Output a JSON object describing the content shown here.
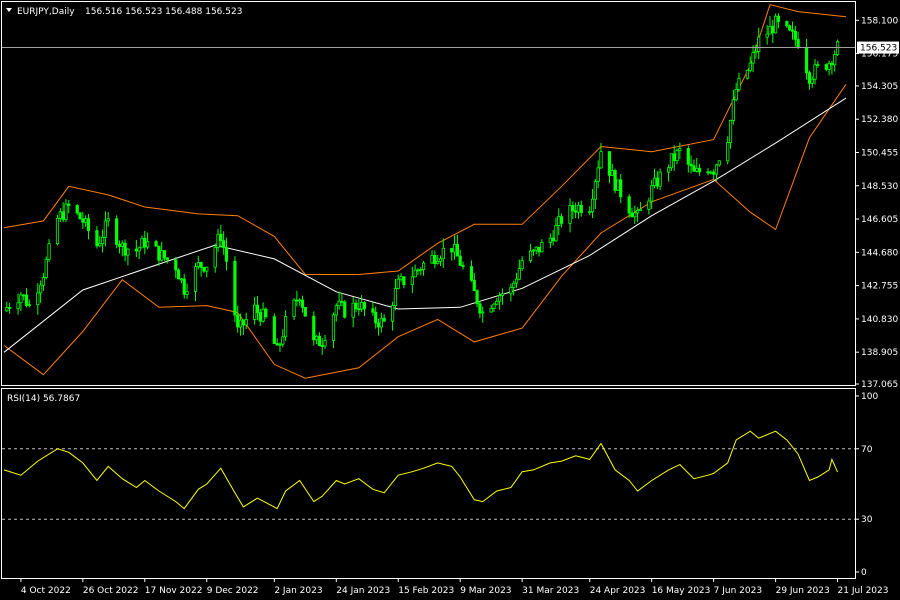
{
  "header": {
    "symbol": "EURJPY,Daily",
    "ohlc": "156.516 156.523 156.488 156.523"
  },
  "current_price_label": "156.523",
  "rsi_header": "RSI(14) 56.7867",
  "colors": {
    "background": "#000000",
    "frame": "#ffffff",
    "candle_up": "#00ff00",
    "candle_down": "#ffffff",
    "bollinger": "#ff7f00",
    "moving_average": "#ffffff",
    "rsi": "#ffff00",
    "rsi_levels": "#c0c0c0"
  },
  "chart_data": [
    {
      "type": "line",
      "name": "price",
      "x_type": "date",
      "x_range": [
        "2022-09-28",
        "2023-07-24"
      ],
      "y_range": [
        137.065,
        159.1
      ],
      "y_ticks": [
        "158.100",
        "156.175",
        "154.305",
        "152.380",
        "150.455",
        "148.530",
        "146.605",
        "144.680",
        "142.755",
        "140.830",
        "138.905",
        "137.065"
      ],
      "x_ticks": [
        {
          "date": "2022-10-04",
          "label": "4 Oct 2022"
        },
        {
          "date": "2022-10-26",
          "label": "26 Oct 2022"
        },
        {
          "date": "2022-11-17",
          "label": "17 Nov 2022"
        },
        {
          "date": "2022-12-09",
          "label": "9 Dec 2022"
        },
        {
          "date": "2023-01-02",
          "label": "2 Jan 2023"
        },
        {
          "date": "2023-01-24",
          "label": "24 Jan 2023"
        },
        {
          "date": "2023-02-15",
          "label": "15 Feb 2023"
        },
        {
          "date": "2023-03-09",
          "label": "9 Mar 2023"
        },
        {
          "date": "2023-03-31",
          "label": "31 Mar 2023"
        },
        {
          "date": "2023-04-24",
          "label": "24 Apr 2023"
        },
        {
          "date": "2023-05-16",
          "label": "16 May 2023"
        },
        {
          "date": "2023-06-07",
          "label": "7 Jun 2023"
        },
        {
          "date": "2023-06-29",
          "label": "29 Jun 2023"
        },
        {
          "date": "2023-07-21",
          "label": "21 Jul 2023"
        }
      ],
      "current_price": 156.523,
      "close": [
        {
          "date": "2022-09-29",
          "value": 141.5
        },
        {
          "date": "2022-10-04",
          "value": 142.3
        },
        {
          "date": "2022-10-07",
          "value": 141.6
        },
        {
          "date": "2022-10-12",
          "value": 143.5
        },
        {
          "date": "2022-10-17",
          "value": 146.6
        },
        {
          "date": "2022-10-21",
          "value": 147.3
        },
        {
          "date": "2022-10-26",
          "value": 146.5
        },
        {
          "date": "2022-10-31",
          "value": 145.1
        },
        {
          "date": "2022-11-04",
          "value": 146.4
        },
        {
          "date": "2022-11-09",
          "value": 145.0
        },
        {
          "date": "2022-11-14",
          "value": 144.8
        },
        {
          "date": "2022-11-17",
          "value": 145.3
        },
        {
          "date": "2022-11-22",
          "value": 144.6
        },
        {
          "date": "2022-11-28",
          "value": 143.9
        },
        {
          "date": "2022-12-01",
          "value": 142.6
        },
        {
          "date": "2022-12-06",
          "value": 143.9
        },
        {
          "date": "2022-12-09",
          "value": 144.0
        },
        {
          "date": "2022-12-14",
          "value": 145.7
        },
        {
          "date": "2022-12-16",
          "value": 144.2
        },
        {
          "date": "2022-12-20",
          "value": 140.1
        },
        {
          "date": "2022-12-26",
          "value": 141.4
        },
        {
          "date": "2022-12-30",
          "value": 140.8
        },
        {
          "date": "2023-01-03",
          "value": 138.9
        },
        {
          "date": "2023-01-06",
          "value": 140.6
        },
        {
          "date": "2023-01-11",
          "value": 142.3
        },
        {
          "date": "2023-01-16",
          "value": 139.4
        },
        {
          "date": "2023-01-19",
          "value": 139.6
        },
        {
          "date": "2023-01-24",
          "value": 141.6
        },
        {
          "date": "2023-01-27",
          "value": 141.3
        },
        {
          "date": "2023-02-01",
          "value": 141.7
        },
        {
          "date": "2023-02-06",
          "value": 140.8
        },
        {
          "date": "2023-02-10",
          "value": 140.6
        },
        {
          "date": "2023-02-15",
          "value": 142.8
        },
        {
          "date": "2023-02-20",
          "value": 143.4
        },
        {
          "date": "2023-02-24",
          "value": 144.0
        },
        {
          "date": "2023-03-01",
          "value": 144.6
        },
        {
          "date": "2023-03-06",
          "value": 145.0
        },
        {
          "date": "2023-03-09",
          "value": 144.1
        },
        {
          "date": "2023-03-14",
          "value": 142.3
        },
        {
          "date": "2023-03-17",
          "value": 141.2
        },
        {
          "date": "2023-03-22",
          "value": 142.2
        },
        {
          "date": "2023-03-27",
          "value": 142.5
        },
        {
          "date": "2023-03-31",
          "value": 144.2
        },
        {
          "date": "2023-04-04",
          "value": 144.6
        },
        {
          "date": "2023-04-10",
          "value": 145.5
        },
        {
          "date": "2023-04-14",
          "value": 146.6
        },
        {
          "date": "2023-04-19",
          "value": 147.3
        },
        {
          "date": "2023-04-24",
          "value": 147.4
        },
        {
          "date": "2023-04-28",
          "value": 150.6
        },
        {
          "date": "2023-05-03",
          "value": 148.7
        },
        {
          "date": "2023-05-08",
          "value": 147.3
        },
        {
          "date": "2023-05-11",
          "value": 146.7
        },
        {
          "date": "2023-05-16",
          "value": 148.3
        },
        {
          "date": "2023-05-22",
          "value": 149.8
        },
        {
          "date": "2023-05-26",
          "value": 150.5
        },
        {
          "date": "2023-05-31",
          "value": 149.2
        },
        {
          "date": "2023-06-05",
          "value": 149.6
        },
        {
          "date": "2023-06-07",
          "value": 149.5
        },
        {
          "date": "2023-06-12",
          "value": 151.4
        },
        {
          "date": "2023-06-15",
          "value": 154.1
        },
        {
          "date": "2023-06-20",
          "value": 155.5
        },
        {
          "date": "2023-06-23",
          "value": 156.9
        },
        {
          "date": "2023-06-29",
          "value": 157.9
        },
        {
          "date": "2023-07-03",
          "value": 157.4
        },
        {
          "date": "2023-07-07",
          "value": 156.9
        },
        {
          "date": "2023-07-11",
          "value": 154.9
        },
        {
          "date": "2023-07-14",
          "value": 155.3
        },
        {
          "date": "2023-07-18",
          "value": 155.7
        },
        {
          "date": "2023-07-21",
          "value": 156.523
        }
      ],
      "moving_average": [
        {
          "date": "2022-09-28",
          "value": 138.9
        },
        {
          "date": "2022-10-26",
          "value": 142.5
        },
        {
          "date": "2022-11-22",
          "value": 144.0
        },
        {
          "date": "2022-12-12",
          "value": 145.1
        },
        {
          "date": "2023-01-02",
          "value": 144.3
        },
        {
          "date": "2023-01-24",
          "value": 142.4
        },
        {
          "date": "2023-02-15",
          "value": 141.4
        },
        {
          "date": "2023-03-09",
          "value": 141.5
        },
        {
          "date": "2023-03-31",
          "value": 142.6
        },
        {
          "date": "2023-04-24",
          "value": 144.5
        },
        {
          "date": "2023-05-16",
          "value": 146.8
        },
        {
          "date": "2023-06-07",
          "value": 148.8
        },
        {
          "date": "2023-06-29",
          "value": 151.0
        },
        {
          "date": "2023-07-24",
          "value": 153.6
        }
      ],
      "bollinger_upper": [
        {
          "date": "2022-09-28",
          "value": 146.1
        },
        {
          "date": "2022-10-12",
          "value": 146.5
        },
        {
          "date": "2022-10-21",
          "value": 148.5
        },
        {
          "date": "2022-11-04",
          "value": 148.0
        },
        {
          "date": "2022-11-17",
          "value": 147.3
        },
        {
          "date": "2022-12-06",
          "value": 146.9
        },
        {
          "date": "2022-12-20",
          "value": 146.8
        },
        {
          "date": "2023-01-02",
          "value": 145.6
        },
        {
          "date": "2023-01-13",
          "value": 143.4
        },
        {
          "date": "2023-02-01",
          "value": 143.4
        },
        {
          "date": "2023-02-15",
          "value": 143.6
        },
        {
          "date": "2023-03-01",
          "value": 145.2
        },
        {
          "date": "2023-03-14",
          "value": 146.3
        },
        {
          "date": "2023-03-31",
          "value": 146.3
        },
        {
          "date": "2023-04-14",
          "value": 148.5
        },
        {
          "date": "2023-04-28",
          "value": 150.8
        },
        {
          "date": "2023-05-16",
          "value": 150.5
        },
        {
          "date": "2023-06-07",
          "value": 151.2
        },
        {
          "date": "2023-06-20",
          "value": 155.5
        },
        {
          "date": "2023-06-27",
          "value": 159.0
        },
        {
          "date": "2023-07-07",
          "value": 158.6
        },
        {
          "date": "2023-07-24",
          "value": 158.3
        }
      ],
      "bollinger_lower": [
        {
          "date": "2022-09-28",
          "value": 139.3
        },
        {
          "date": "2022-10-12",
          "value": 137.6
        },
        {
          "date": "2022-10-26",
          "value": 140.1
        },
        {
          "date": "2022-11-09",
          "value": 143.1
        },
        {
          "date": "2022-11-22",
          "value": 141.5
        },
        {
          "date": "2022-12-09",
          "value": 141.6
        },
        {
          "date": "2022-12-20",
          "value": 141.2
        },
        {
          "date": "2023-01-02",
          "value": 138.2
        },
        {
          "date": "2023-01-13",
          "value": 137.4
        },
        {
          "date": "2023-02-01",
          "value": 138.0
        },
        {
          "date": "2023-02-15",
          "value": 139.8
        },
        {
          "date": "2023-03-01",
          "value": 140.8
        },
        {
          "date": "2023-03-14",
          "value": 139.5
        },
        {
          "date": "2023-03-31",
          "value": 140.3
        },
        {
          "date": "2023-04-14",
          "value": 143.3
        },
        {
          "date": "2023-04-28",
          "value": 145.8
        },
        {
          "date": "2023-05-16",
          "value": 147.6
        },
        {
          "date": "2023-06-07",
          "value": 148.9
        },
        {
          "date": "2023-06-20",
          "value": 147.0
        },
        {
          "date": "2023-06-29",
          "value": 146.0
        },
        {
          "date": "2023-07-11",
          "value": 151.3
        },
        {
          "date": "2023-07-24",
          "value": 154.4
        }
      ]
    },
    {
      "type": "line",
      "name": "RSI(14)",
      "x_type": "date",
      "x_range": [
        "2022-09-28",
        "2023-07-24"
      ],
      "y_range": [
        0,
        100
      ],
      "y_ticks": [
        "100",
        "70",
        "30",
        "0"
      ],
      "levels": [
        70,
        30
      ],
      "current_value": 56.7867,
      "values": [
        {
          "date": "2022-09-28",
          "value": 58
        },
        {
          "date": "2022-10-04",
          "value": 55
        },
        {
          "date": "2022-10-10",
          "value": 63
        },
        {
          "date": "2022-10-17",
          "value": 70
        },
        {
          "date": "2022-10-21",
          "value": 68
        },
        {
          "date": "2022-10-26",
          "value": 62
        },
        {
          "date": "2022-10-31",
          "value": 52
        },
        {
          "date": "2022-11-04",
          "value": 60
        },
        {
          "date": "2022-11-09",
          "value": 53
        },
        {
          "date": "2022-11-14",
          "value": 48
        },
        {
          "date": "2022-11-17",
          "value": 52
        },
        {
          "date": "2022-11-22",
          "value": 46
        },
        {
          "date": "2022-11-28",
          "value": 40
        },
        {
          "date": "2022-12-01",
          "value": 36
        },
        {
          "date": "2022-12-06",
          "value": 47
        },
        {
          "date": "2022-12-09",
          "value": 50
        },
        {
          "date": "2022-12-14",
          "value": 59
        },
        {
          "date": "2022-12-19",
          "value": 45
        },
        {
          "date": "2022-12-22",
          "value": 37
        },
        {
          "date": "2022-12-27",
          "value": 42
        },
        {
          "date": "2023-01-03",
          "value": 36
        },
        {
          "date": "2023-01-06",
          "value": 46
        },
        {
          "date": "2023-01-11",
          "value": 52
        },
        {
          "date": "2023-01-16",
          "value": 40
        },
        {
          "date": "2023-01-19",
          "value": 43
        },
        {
          "date": "2023-01-24",
          "value": 52
        },
        {
          "date": "2023-01-27",
          "value": 50
        },
        {
          "date": "2023-02-01",
          "value": 53
        },
        {
          "date": "2023-02-06",
          "value": 47
        },
        {
          "date": "2023-02-10",
          "value": 45
        },
        {
          "date": "2023-02-15",
          "value": 55
        },
        {
          "date": "2023-02-20",
          "value": 57
        },
        {
          "date": "2023-02-24",
          "value": 59
        },
        {
          "date": "2023-03-01",
          "value": 62
        },
        {
          "date": "2023-03-06",
          "value": 60
        },
        {
          "date": "2023-03-09",
          "value": 54
        },
        {
          "date": "2023-03-14",
          "value": 41
        },
        {
          "date": "2023-03-17",
          "value": 40
        },
        {
          "date": "2023-03-22",
          "value": 46
        },
        {
          "date": "2023-03-27",
          "value": 48
        },
        {
          "date": "2023-03-31",
          "value": 57
        },
        {
          "date": "2023-04-04",
          "value": 58
        },
        {
          "date": "2023-04-10",
          "value": 62
        },
        {
          "date": "2023-04-14",
          "value": 63
        },
        {
          "date": "2023-04-19",
          "value": 66
        },
        {
          "date": "2023-04-24",
          "value": 64
        },
        {
          "date": "2023-04-28",
          "value": 73
        },
        {
          "date": "2023-05-03",
          "value": 58
        },
        {
          "date": "2023-05-08",
          "value": 52
        },
        {
          "date": "2023-05-11",
          "value": 46
        },
        {
          "date": "2023-05-16",
          "value": 52
        },
        {
          "date": "2023-05-22",
          "value": 58
        },
        {
          "date": "2023-05-26",
          "value": 61
        },
        {
          "date": "2023-05-31",
          "value": 53
        },
        {
          "date": "2023-06-05",
          "value": 55
        },
        {
          "date": "2023-06-07",
          "value": 56
        },
        {
          "date": "2023-06-12",
          "value": 62
        },
        {
          "date": "2023-06-15",
          "value": 75
        },
        {
          "date": "2023-06-20",
          "value": 80
        },
        {
          "date": "2023-06-23",
          "value": 76
        },
        {
          "date": "2023-06-29",
          "value": 80
        },
        {
          "date": "2023-07-03",
          "value": 75
        },
        {
          "date": "2023-07-07",
          "value": 67
        },
        {
          "date": "2023-07-11",
          "value": 52
        },
        {
          "date": "2023-07-14",
          "value": 54
        },
        {
          "date": "2023-07-18",
          "value": 58
        },
        {
          "date": "2023-07-19",
          "value": 64
        },
        {
          "date": "2023-07-21",
          "value": 56.7867
        }
      ]
    }
  ]
}
